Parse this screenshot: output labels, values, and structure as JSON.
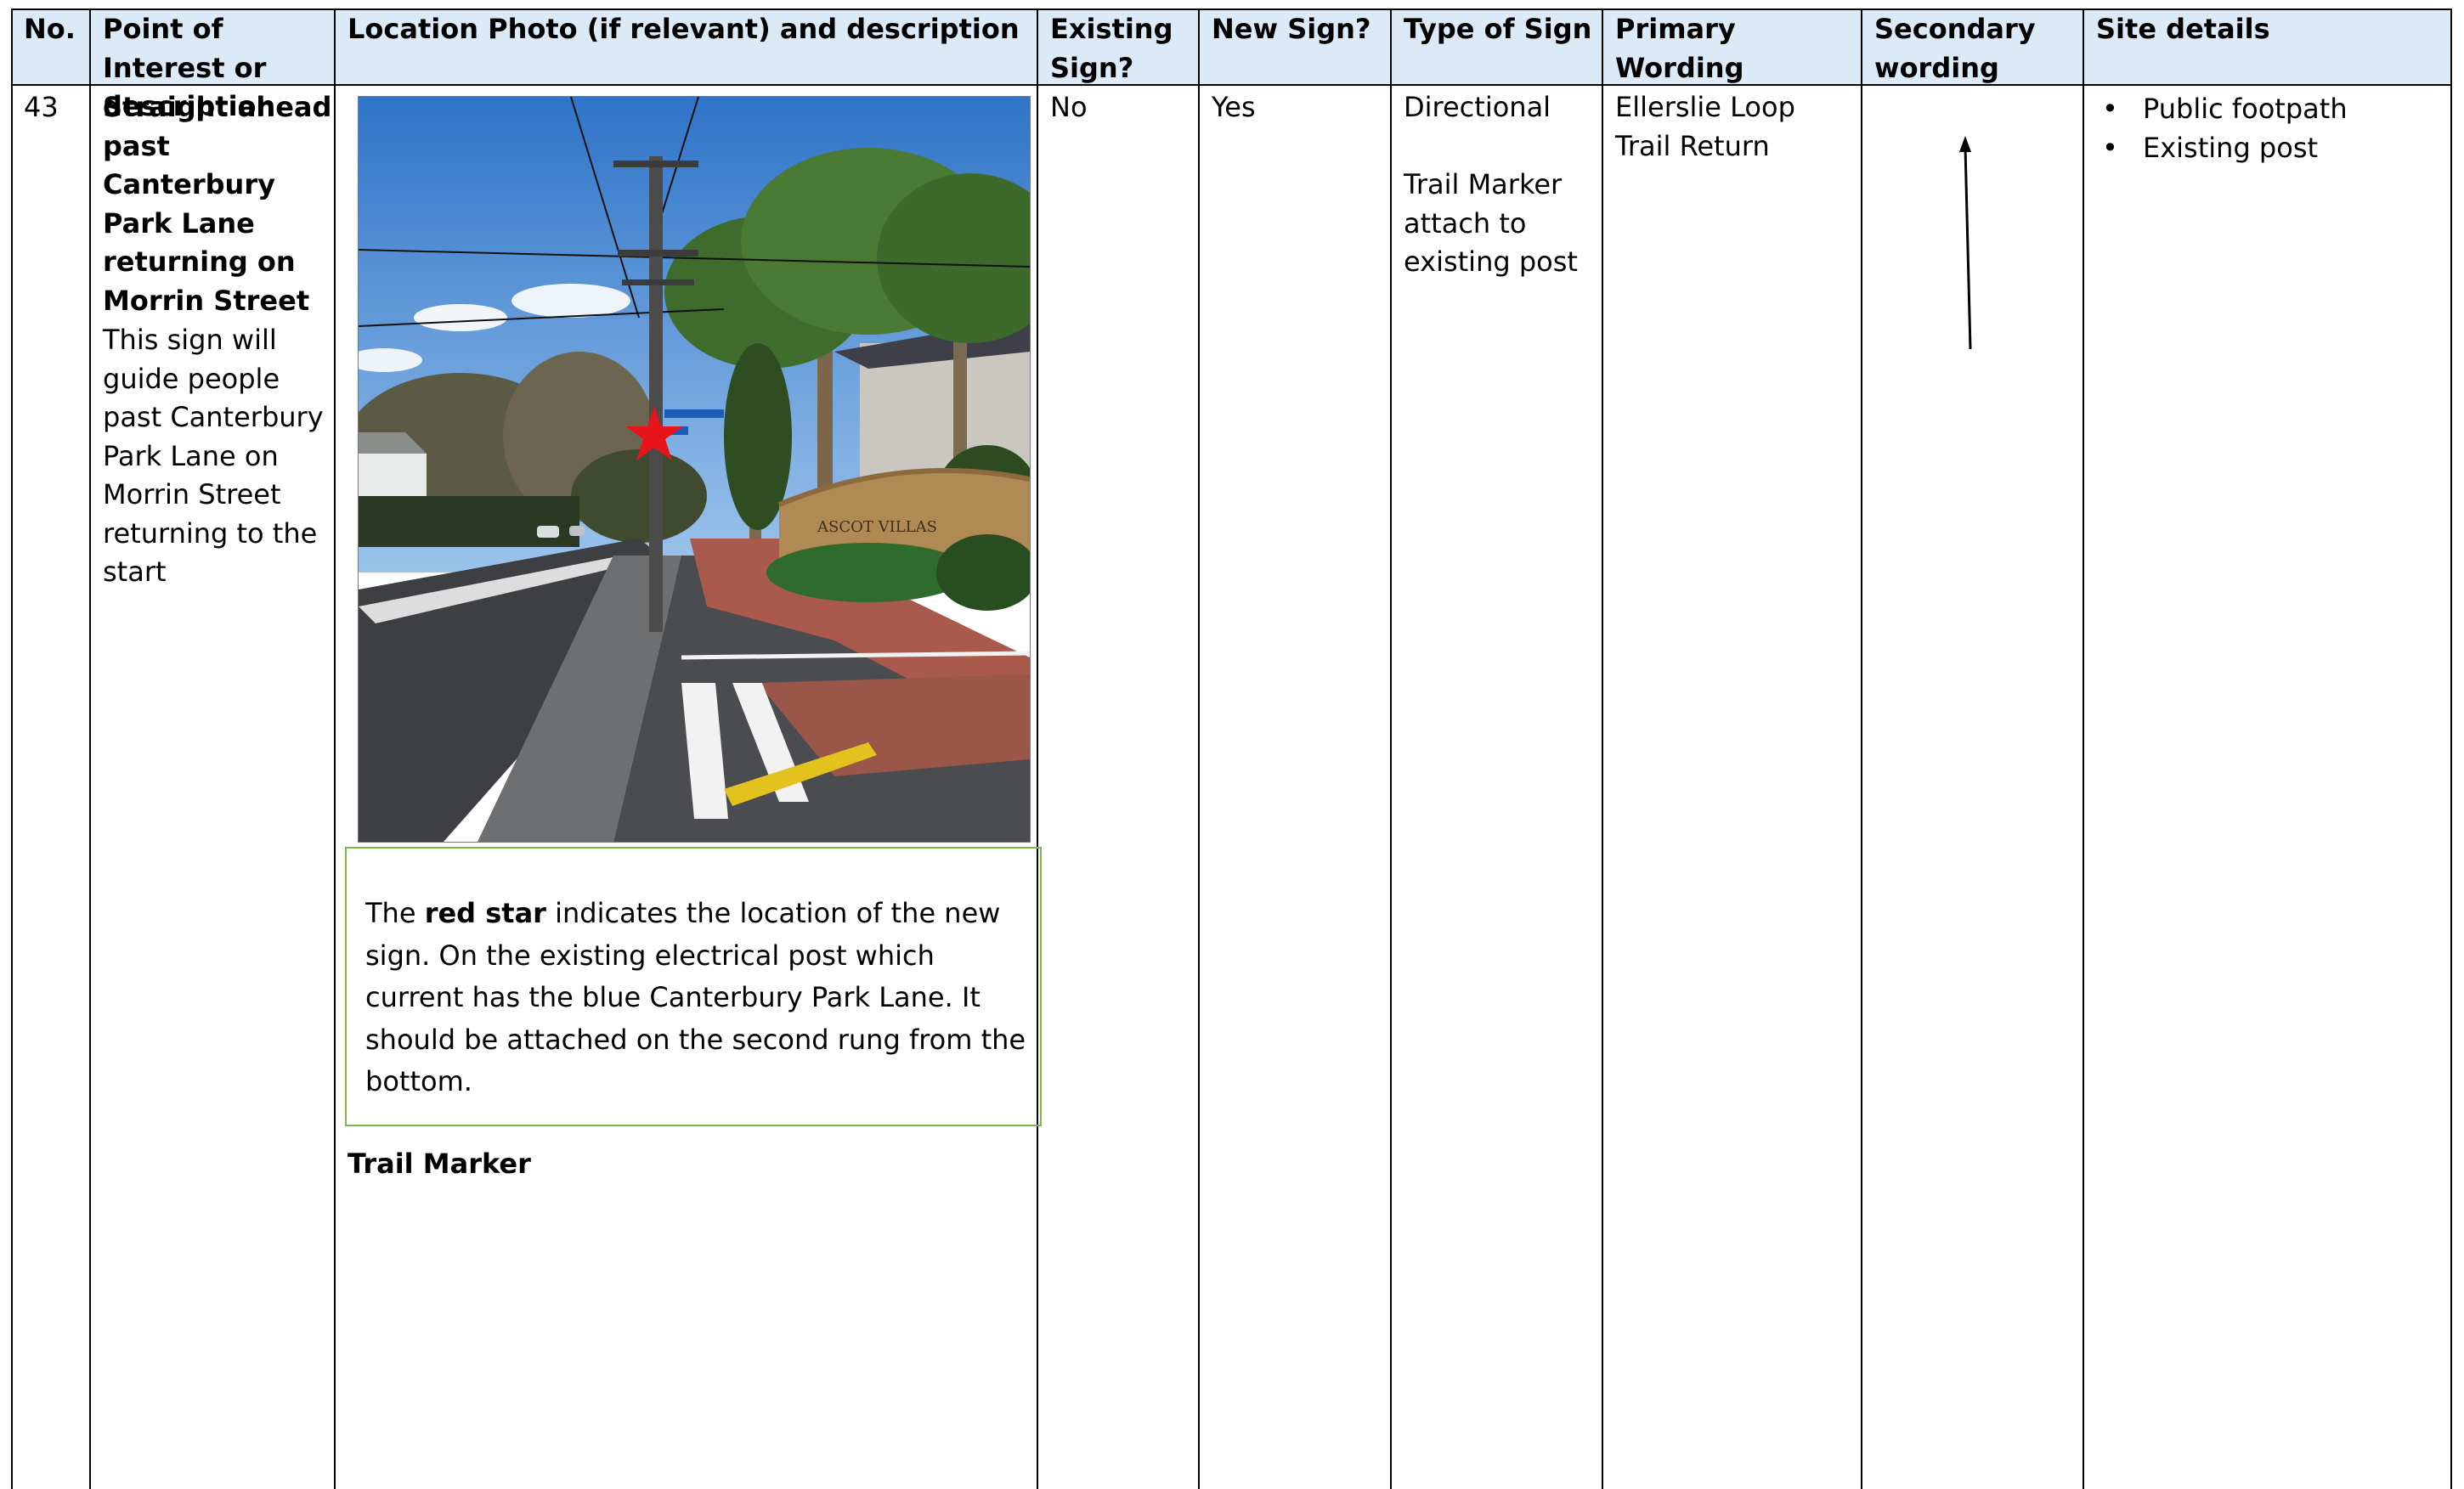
{
  "columns": {
    "no": "No.",
    "poi": "Point of Interest or description",
    "photo": "Location Photo (if relevant) and description",
    "existing": "Existing Sign?",
    "new_sign": "New Sign?",
    "type": "Type of Sign",
    "primary": "Primary Wording",
    "secondary": "Secondary wording",
    "site": "Site details"
  },
  "row": {
    "no": "43",
    "poi_title": "Straight ahead past Canterbury Park Lane returning on Morrin Street",
    "poi_desc": "This sign will guide people past Canterbury Park Lane on Morrin Street returning to the start",
    "photo_sign_text": "ASCOT VILLAS",
    "caption_pre": "The ",
    "caption_bold": "red star",
    "caption_post": " indicates the location of the new sign. On the existing electrical post which current has the blue Canterbury Park Lane. It should be attached on the second rung from the bottom.",
    "trail_marker_heading": "Trail Marker",
    "existing": "No",
    "new_sign": "Yes",
    "type_main": "Directional",
    "type_sub": "Trail Marker attach to existing post",
    "primary": "Ellerslie Loop Trail Return",
    "secondary_icon": "up-arrow-icon",
    "site_details": [
      "Public footpath",
      "Existing post"
    ]
  },
  "colors": {
    "header_bg": "#dce9f6",
    "caption_border": "#76b84a",
    "star": "#e8141c"
  }
}
